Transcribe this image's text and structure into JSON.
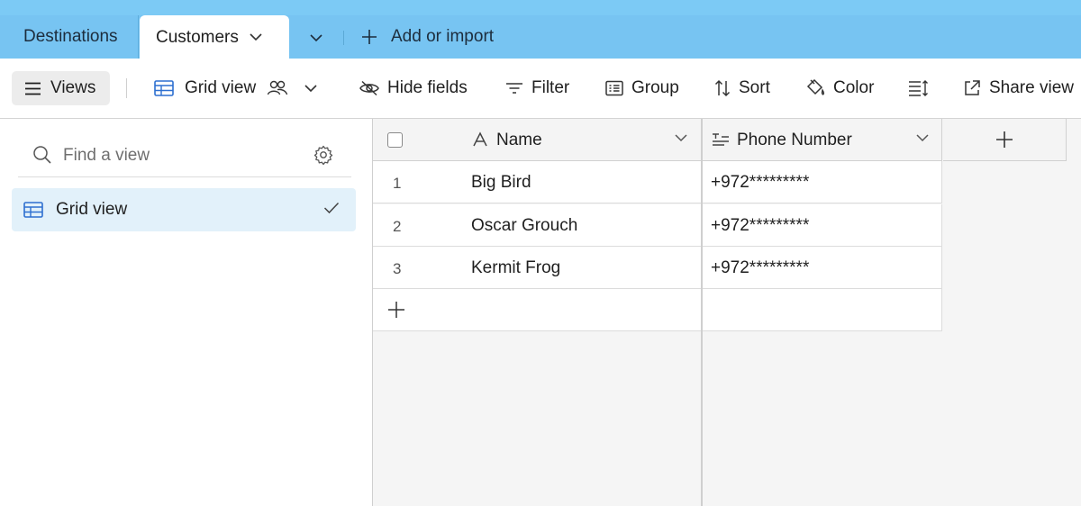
{
  "tabs": {
    "destinations": "Destinations",
    "customers": "Customers",
    "add_or_import": "Add or import"
  },
  "toolbar": {
    "views": "Views",
    "grid_view": "Grid view",
    "hide_fields": "Hide fields",
    "filter": "Filter",
    "group": "Group",
    "sort": "Sort",
    "color": "Color",
    "share_view": "Share view"
  },
  "sidebar": {
    "search_placeholder": "Find a view",
    "views": [
      {
        "label": "Grid view",
        "selected": true
      }
    ]
  },
  "grid": {
    "columns": [
      {
        "label": "Name",
        "type": "single-line-text"
      },
      {
        "label": "Phone Number",
        "type": "long-text"
      }
    ],
    "rows": [
      {
        "num": "1",
        "name": "Big Bird",
        "phone": "+972*********"
      },
      {
        "num": "2",
        "name": "Oscar Grouch",
        "phone": "+972*********"
      },
      {
        "num": "3",
        "name": "Kermit Frog",
        "phone": "+972*********"
      }
    ]
  },
  "colors": {
    "tab_bar": "#77c4f2",
    "selected_view": "#e2f1fa",
    "grid_icon": "#2d6fd0"
  }
}
